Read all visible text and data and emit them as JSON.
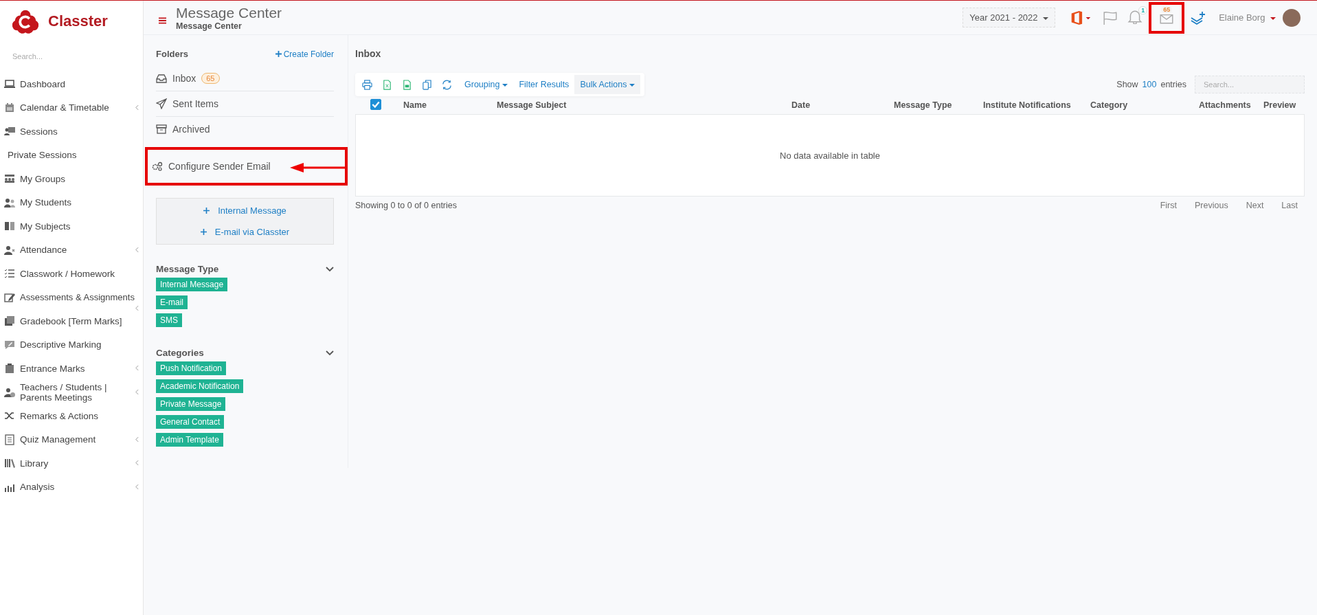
{
  "sidebar": {
    "logo": "Classter",
    "search": {
      "placeholder": "Search..."
    },
    "items": [
      {
        "label": "Dashboard",
        "kind": "item",
        "submenu": false
      },
      {
        "label": "Calendar & Timetable",
        "kind": "item",
        "submenu": true
      },
      {
        "label": "Sessions",
        "kind": "item",
        "submenu": false
      },
      {
        "label": "Private Sessions",
        "kind": "sub",
        "submenu": false
      },
      {
        "label": "My Groups",
        "kind": "item",
        "submenu": false
      },
      {
        "label": "My Students",
        "kind": "item",
        "submenu": false
      },
      {
        "label": "My Subjects",
        "kind": "item",
        "submenu": false
      },
      {
        "label": "Attendance",
        "kind": "item",
        "submenu": true
      },
      {
        "label": "Classwork / Homework",
        "kind": "item",
        "submenu": false
      },
      {
        "label": "Assessments & Assignments",
        "kind": "item",
        "submenu": true
      },
      {
        "label": "Gradebook [Term Marks]",
        "kind": "item",
        "submenu": false
      },
      {
        "label": "Descriptive Marking",
        "kind": "item",
        "submenu": false
      },
      {
        "label": "Entrance Marks",
        "kind": "item",
        "submenu": true
      },
      {
        "label": "Teachers / Students | Parents Meetings",
        "kind": "item",
        "submenu": true
      },
      {
        "label": "Remarks & Actions",
        "kind": "item",
        "submenu": false
      },
      {
        "label": "Quiz Management",
        "kind": "item",
        "submenu": true
      },
      {
        "label": "Library",
        "kind": "item",
        "submenu": true
      },
      {
        "label": "Analysis",
        "kind": "item",
        "submenu": true
      }
    ]
  },
  "header": {
    "title": "Message Center",
    "subtitle": "Message Center",
    "year": "Year 2021 - 2022",
    "notifications_badge": "1",
    "messages_badge": "65",
    "messages_highlighted": true,
    "user": "Elaine Borg"
  },
  "folders": {
    "title": "Folders",
    "create": "Create Folder",
    "items": [
      {
        "label": "Inbox",
        "badge": "65",
        "highlighted": false
      },
      {
        "label": "Sent Items",
        "highlighted": false
      },
      {
        "label": "Archived",
        "highlighted": false
      },
      {
        "label": "Configure Sender Email",
        "highlighted": true
      }
    ]
  },
  "compose": [
    "Internal Message",
    "E-mail via Classter"
  ],
  "filters": [
    {
      "title": "Message Type",
      "tags": [
        "Internal Message",
        "E-mail",
        "SMS"
      ]
    },
    {
      "title": "Categories",
      "tags": [
        "Push Notification",
        "Academic Notification",
        "Private Message",
        "General Contact",
        "Admin Template"
      ]
    }
  ],
  "inbox": {
    "title": "Inbox",
    "toolbar": [
      {
        "label": "Grouping",
        "caret": true,
        "selected": false
      },
      {
        "label": "Filter Results",
        "caret": false,
        "selected": false
      },
      {
        "label": "Bulk Actions",
        "caret": true,
        "selected": true
      }
    ],
    "show": "Show",
    "entries_count": "100",
    "entries": "entries",
    "search_placeholder": "Search...",
    "select_all_checked": true,
    "columns": [
      "Name",
      "Message Subject",
      "Date",
      "Message Type",
      "Institute Notifications",
      "Category",
      "Attachments",
      "Preview"
    ],
    "empty": "No data available in table",
    "info": "Showing 0 to 0 of 0 entries",
    "pagination": [
      "First",
      "Previous",
      "Next",
      "Last"
    ]
  }
}
